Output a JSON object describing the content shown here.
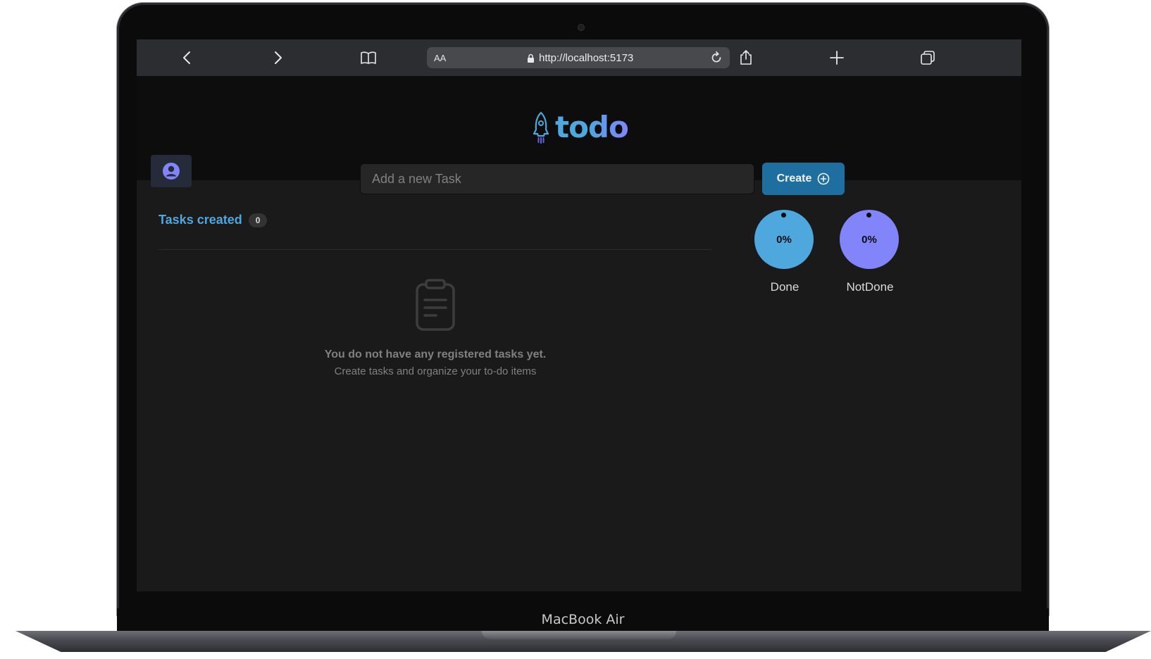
{
  "device": {
    "label": "MacBook Air"
  },
  "browser": {
    "url": "http://localhost:5173",
    "reader_label": "AA",
    "icons": [
      "back-icon",
      "forward-icon",
      "bookmarks-icon",
      "lock-icon",
      "reload-icon",
      "share-icon",
      "new-tab-icon",
      "tabs-icon"
    ]
  },
  "app": {
    "logo_text": "todo",
    "input_placeholder": "Add a new Task",
    "create_label": "Create",
    "tasks_created_label": "Tasks created",
    "tasks_created_count": "0",
    "empty_title": "You do not have any registered tasks yet.",
    "empty_subtitle": "Create tasks and organize your to-do items",
    "stats": [
      {
        "label": "Done",
        "value": "0%",
        "color": "#4ea8de"
      },
      {
        "label": "NotDone",
        "value": "0%",
        "color": "#8284fa"
      }
    ]
  },
  "colors": {
    "blue": "#4ea8de",
    "purple": "#8284fa",
    "button": "#1e6f9f",
    "background": "#1a1a1a",
    "header": "#0d0d0d"
  }
}
